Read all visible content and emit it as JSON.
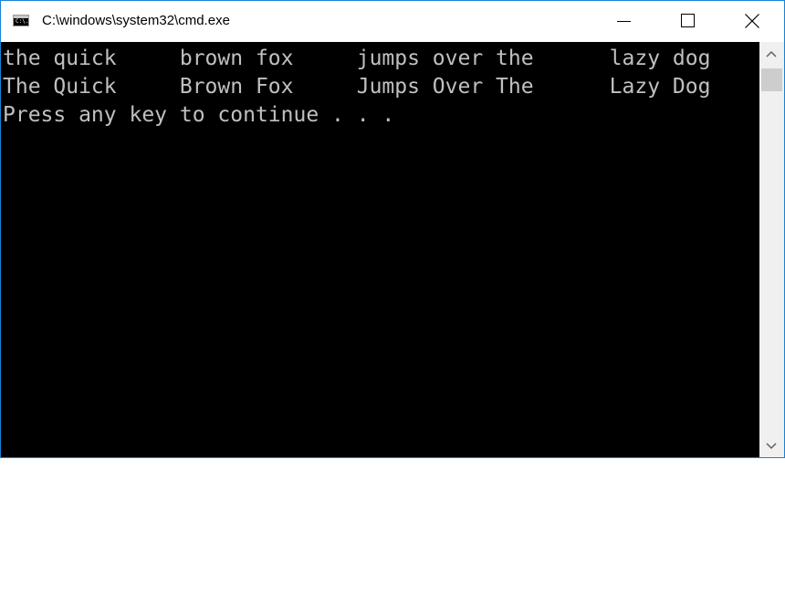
{
  "window": {
    "title": "C:\\windows\\system32\\cmd.exe",
    "icon": "console-app-icon",
    "icon_glyph": "C:\\."
  },
  "controls": {
    "minimize_icon": "minimize-icon",
    "maximize_icon": "maximize-icon",
    "close_icon": "close-icon"
  },
  "console": {
    "background": "#000000",
    "text_color": "#c0c0c0",
    "lines": [
      "the quick     brown fox     jumps over the      lazy dog",
      "The Quick     Brown Fox     Jumps Over The      Lazy Dog",
      "Press any key to continue . . ."
    ]
  },
  "scrollbar": {
    "up_icon": "scroll-up-arrow-icon",
    "down_icon": "scroll-down-arrow-icon"
  },
  "colors": {
    "window_border": "#1883d7",
    "scrollbar_track": "#f0f0f0",
    "scrollbar_thumb": "#cdcdcd"
  }
}
